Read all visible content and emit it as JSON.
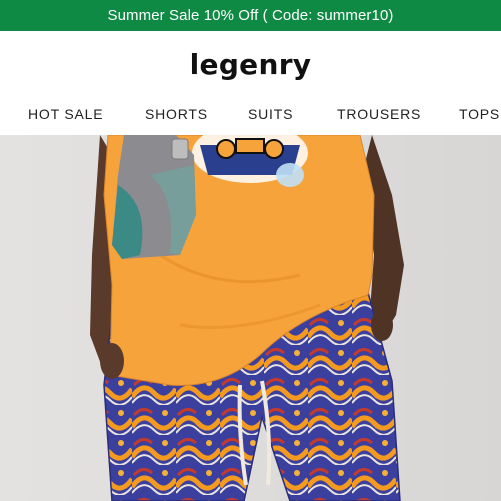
{
  "announcement": {
    "text": "Summer Sale 10% Off ( Code: summer10)",
    "background": "#0f8a45"
  },
  "header": {
    "logo": "legenry"
  },
  "nav": {
    "items": [
      {
        "label": "HOT SALE"
      },
      {
        "label": "SHORTS"
      },
      {
        "label": "SUITS"
      },
      {
        "label": "TROUSERS"
      },
      {
        "label": "TOPS"
      }
    ]
  },
  "hero": {
    "image": "model-wearing-orange-tee-and-wave-print-shorts"
  }
}
